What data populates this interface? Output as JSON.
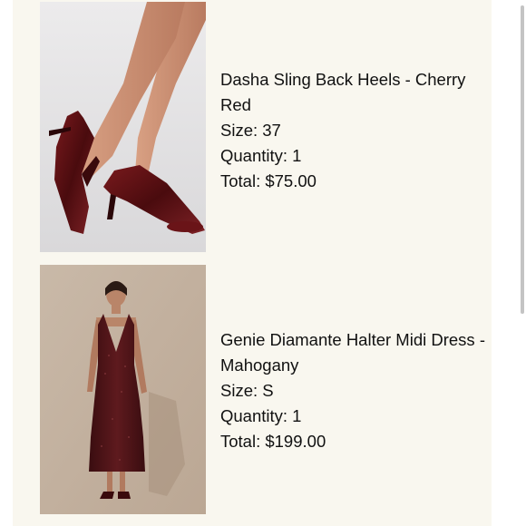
{
  "cart": {
    "items": [
      {
        "name": "Dasha Sling Back Heels - Cherry Red",
        "size": "Size: 37",
        "quantity": "Quantity: 1",
        "total": "Total: $75.00"
      },
      {
        "name": "Genie Diamante Halter Midi Dress - Mahogany",
        "size": "Size: S",
        "quantity": "Quantity: 1",
        "total": "Total: $199.00"
      }
    ]
  },
  "colors": {
    "background": "#f9f7ef",
    "text": "#111111",
    "shoe": "#5a0f12",
    "dress": "#4a1418"
  }
}
